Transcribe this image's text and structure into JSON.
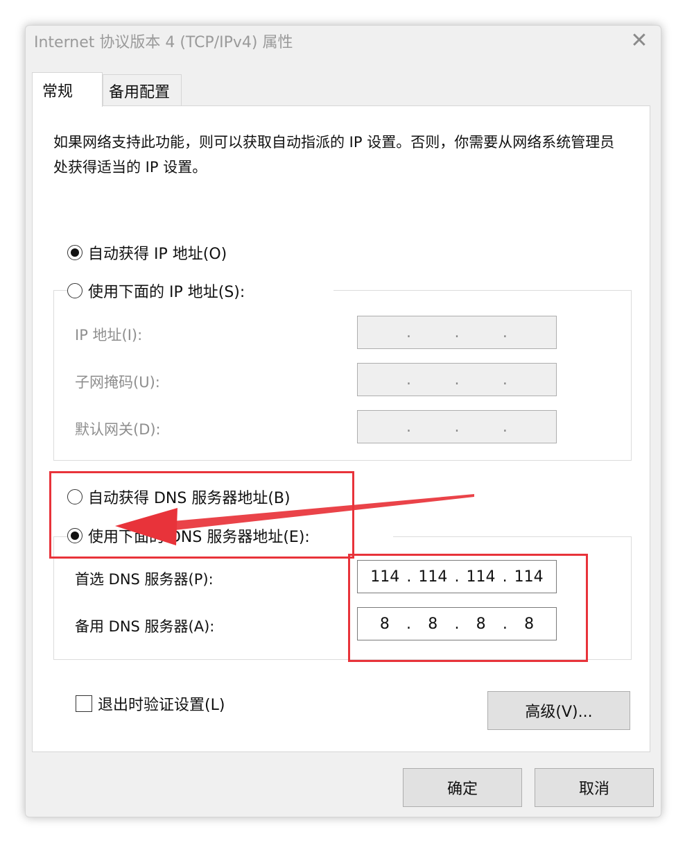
{
  "window": {
    "title": "Internet 协议版本 4 (TCP/IPv4) 属性"
  },
  "tabs": [
    {
      "label": "常规",
      "active": true
    },
    {
      "label": "备用配置",
      "active": false
    }
  ],
  "general": {
    "description": "如果网络支持此功能，则可以获取自动指派的 IP 设置。否则，你需要从网络系统管理员处获得适当的 IP 设置。",
    "ip_auto_label": "自动获得 IP 地址(O)",
    "ip_manual_label": "使用下面的 IP 地址(S):",
    "ip_mode": "auto",
    "ip_fields": [
      {
        "label": "IP 地址(I):",
        "octets": [
          "",
          "",
          "",
          ""
        ]
      },
      {
        "label": "子网掩码(U):",
        "octets": [
          "",
          "",
          "",
          ""
        ]
      },
      {
        "label": "默认网关(D):",
        "octets": [
          "",
          "",
          "",
          ""
        ]
      }
    ],
    "dns_auto_label": "自动获得 DNS 服务器地址(B)",
    "dns_manual_label": "使用下面的 DNS 服务器地址(E):",
    "dns_mode": "manual",
    "dns_fields": [
      {
        "label": "首选 DNS 服务器(P):",
        "octets": [
          "114",
          "114",
          "114",
          "114"
        ]
      },
      {
        "label": "备用 DNS 服务器(A):",
        "octets": [
          "8",
          "8",
          "8",
          "8"
        ]
      }
    ],
    "validate_label": "退出时验证设置(L)",
    "validate_checked": false,
    "advanced_label": "高级(V)..."
  },
  "buttons": {
    "ok": "确定",
    "cancel": "取消"
  },
  "annotation": {
    "color": "#e8333a"
  }
}
